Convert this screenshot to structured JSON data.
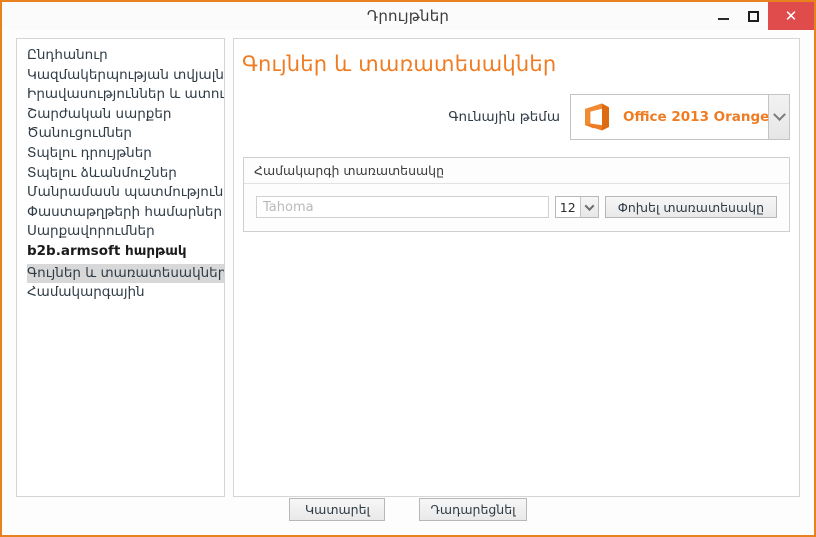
{
  "window": {
    "title": "Դրույթներ",
    "accent_color": "#e8821e",
    "controls": {
      "minimize": "minimize-icon",
      "maximize": "maximize-icon",
      "close": "✕"
    }
  },
  "sidebar": {
    "items": [
      {
        "label": "Ընդհանուր",
        "selected": false,
        "bold": false
      },
      {
        "label": "Կազմակերպության տվյալներ",
        "selected": false,
        "bold": false
      },
      {
        "label": "Իրավասություններ և ատուգումներ",
        "selected": false,
        "bold": false
      },
      {
        "label": "Շարժական սարքեր",
        "selected": false,
        "bold": false
      },
      {
        "label": "Ծանուցումներ",
        "selected": false,
        "bold": false
      },
      {
        "label": "Տպելու դրույթներ",
        "selected": false,
        "bold": false
      },
      {
        "label": "Տպելու ձևանմուշներ",
        "selected": false,
        "bold": false
      },
      {
        "label": "Մանրամասն պատմություն",
        "selected": false,
        "bold": false
      },
      {
        "label": "Փաստաթղթերի համարներ",
        "selected": false,
        "bold": false
      },
      {
        "label": "Սարքավորումներ",
        "selected": false,
        "bold": false
      },
      {
        "label": "b2b.armsoft հարթակ",
        "selected": false,
        "bold": true
      },
      {
        "label": "Գույներ և տառատեսակներ",
        "selected": true,
        "bold": false
      },
      {
        "label": "Համակարգային",
        "selected": false,
        "bold": false
      }
    ]
  },
  "main": {
    "page_title": "Գույներ և տառատեսակներ",
    "title_color": "#ef7c23",
    "theme": {
      "label": "Գունային թեմա",
      "selected_value": "Office 2013 Orange",
      "value_color": "#ef7c23",
      "logo_icon": "office-logo-icon",
      "arrow_icon": "chevron-down-icon"
    },
    "font_group": {
      "header": "Համակարգի տառատեսակը",
      "font_name_placeholder": "Tahoma",
      "font_name_value": "",
      "font_size": "12",
      "size_arrow_icon": "chevron-down-icon",
      "change_button": "Փոխել տառատեսակը"
    }
  },
  "footer": {
    "ok_label": "Կատարել",
    "cancel_label": "Դադարեցնել"
  }
}
